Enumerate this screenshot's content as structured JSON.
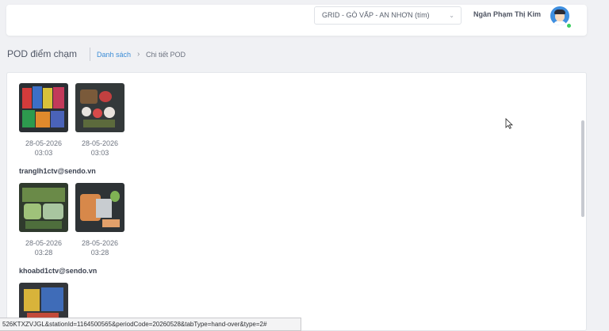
{
  "header": {
    "station_select_value": "GRID - GÒ VẤP - AN NHƠN (tím)",
    "user_name": "Ngân Phạm Thị Kim"
  },
  "page": {
    "title": "POD điểm chạm",
    "breadcrumb": {
      "link": "Danh sách",
      "separator": "›",
      "current": "Chi tiết POD"
    }
  },
  "groups": [
    {
      "email": "",
      "photos": [
        {
          "date": "28-05-2026",
          "time": "03:03"
        },
        {
          "date": "28-05-2026",
          "time": "03:03"
        }
      ]
    },
    {
      "email": "tranglh1ctv@sendo.vn",
      "photos": [
        {
          "date": "28-05-2026",
          "time": "03:28"
        },
        {
          "date": "28-05-2026",
          "time": "03:28"
        }
      ]
    },
    {
      "email": "khoabd1ctv@sendo.vn",
      "photos": []
    }
  ],
  "status_url": "526KTXZVJGL&stationId=1164500565&periodCode=20260528&tabType=hand-over&type=2#",
  "colors": {
    "link": "#3b8cd6",
    "online": "#3ccf61",
    "avatar_bg": "#3f8fe0"
  }
}
